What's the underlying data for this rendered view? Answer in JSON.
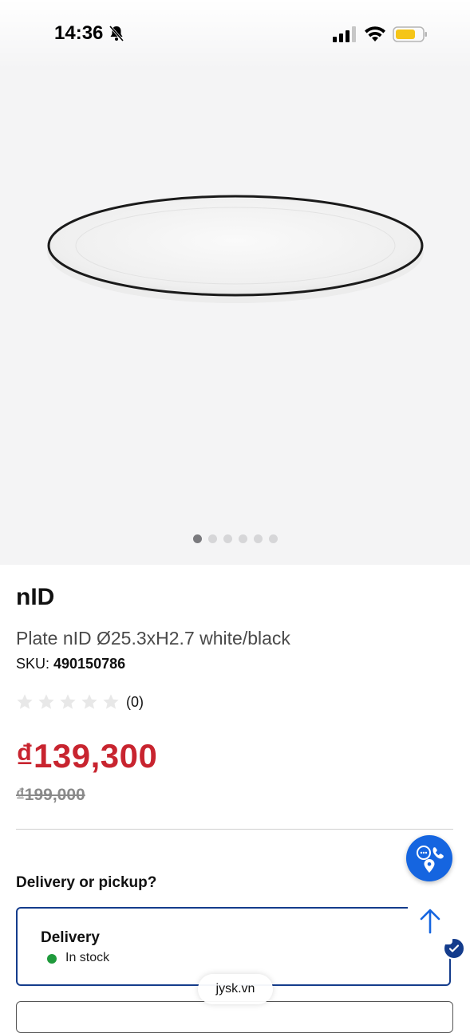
{
  "status_bar": {
    "time": "14:36",
    "icons": [
      "bell-slash-icon",
      "signal-icon",
      "wifi-icon",
      "battery-icon"
    ],
    "battery_color": "#f5c518"
  },
  "gallery": {
    "image": "white-plate-with-black-rim",
    "dots_total": 6,
    "active_index": 0
  },
  "product": {
    "brand": "nID",
    "name": "Plate nID Ø25.3xH2.7 white/black",
    "sku_label": "SKU: ",
    "sku_value": "490150786",
    "rating_stars": 0,
    "rating_max": 5,
    "review_count": "(0)",
    "price": "₫139,300",
    "old_price": "₫199,000",
    "price_color": "#c8242f"
  },
  "delivery": {
    "heading": "Delivery or pickup?",
    "option_title": "Delivery",
    "stock_status": "In stock",
    "selected": true,
    "accent_color": "#143c8c",
    "stock_color": "#1f9a3c"
  },
  "floating": {
    "contact_icon": "chat-phone-location-icon",
    "contact_color": "#1565e0",
    "scroll_top_icon": "arrow-up-icon"
  },
  "browser": {
    "url": "jysk.vn"
  }
}
